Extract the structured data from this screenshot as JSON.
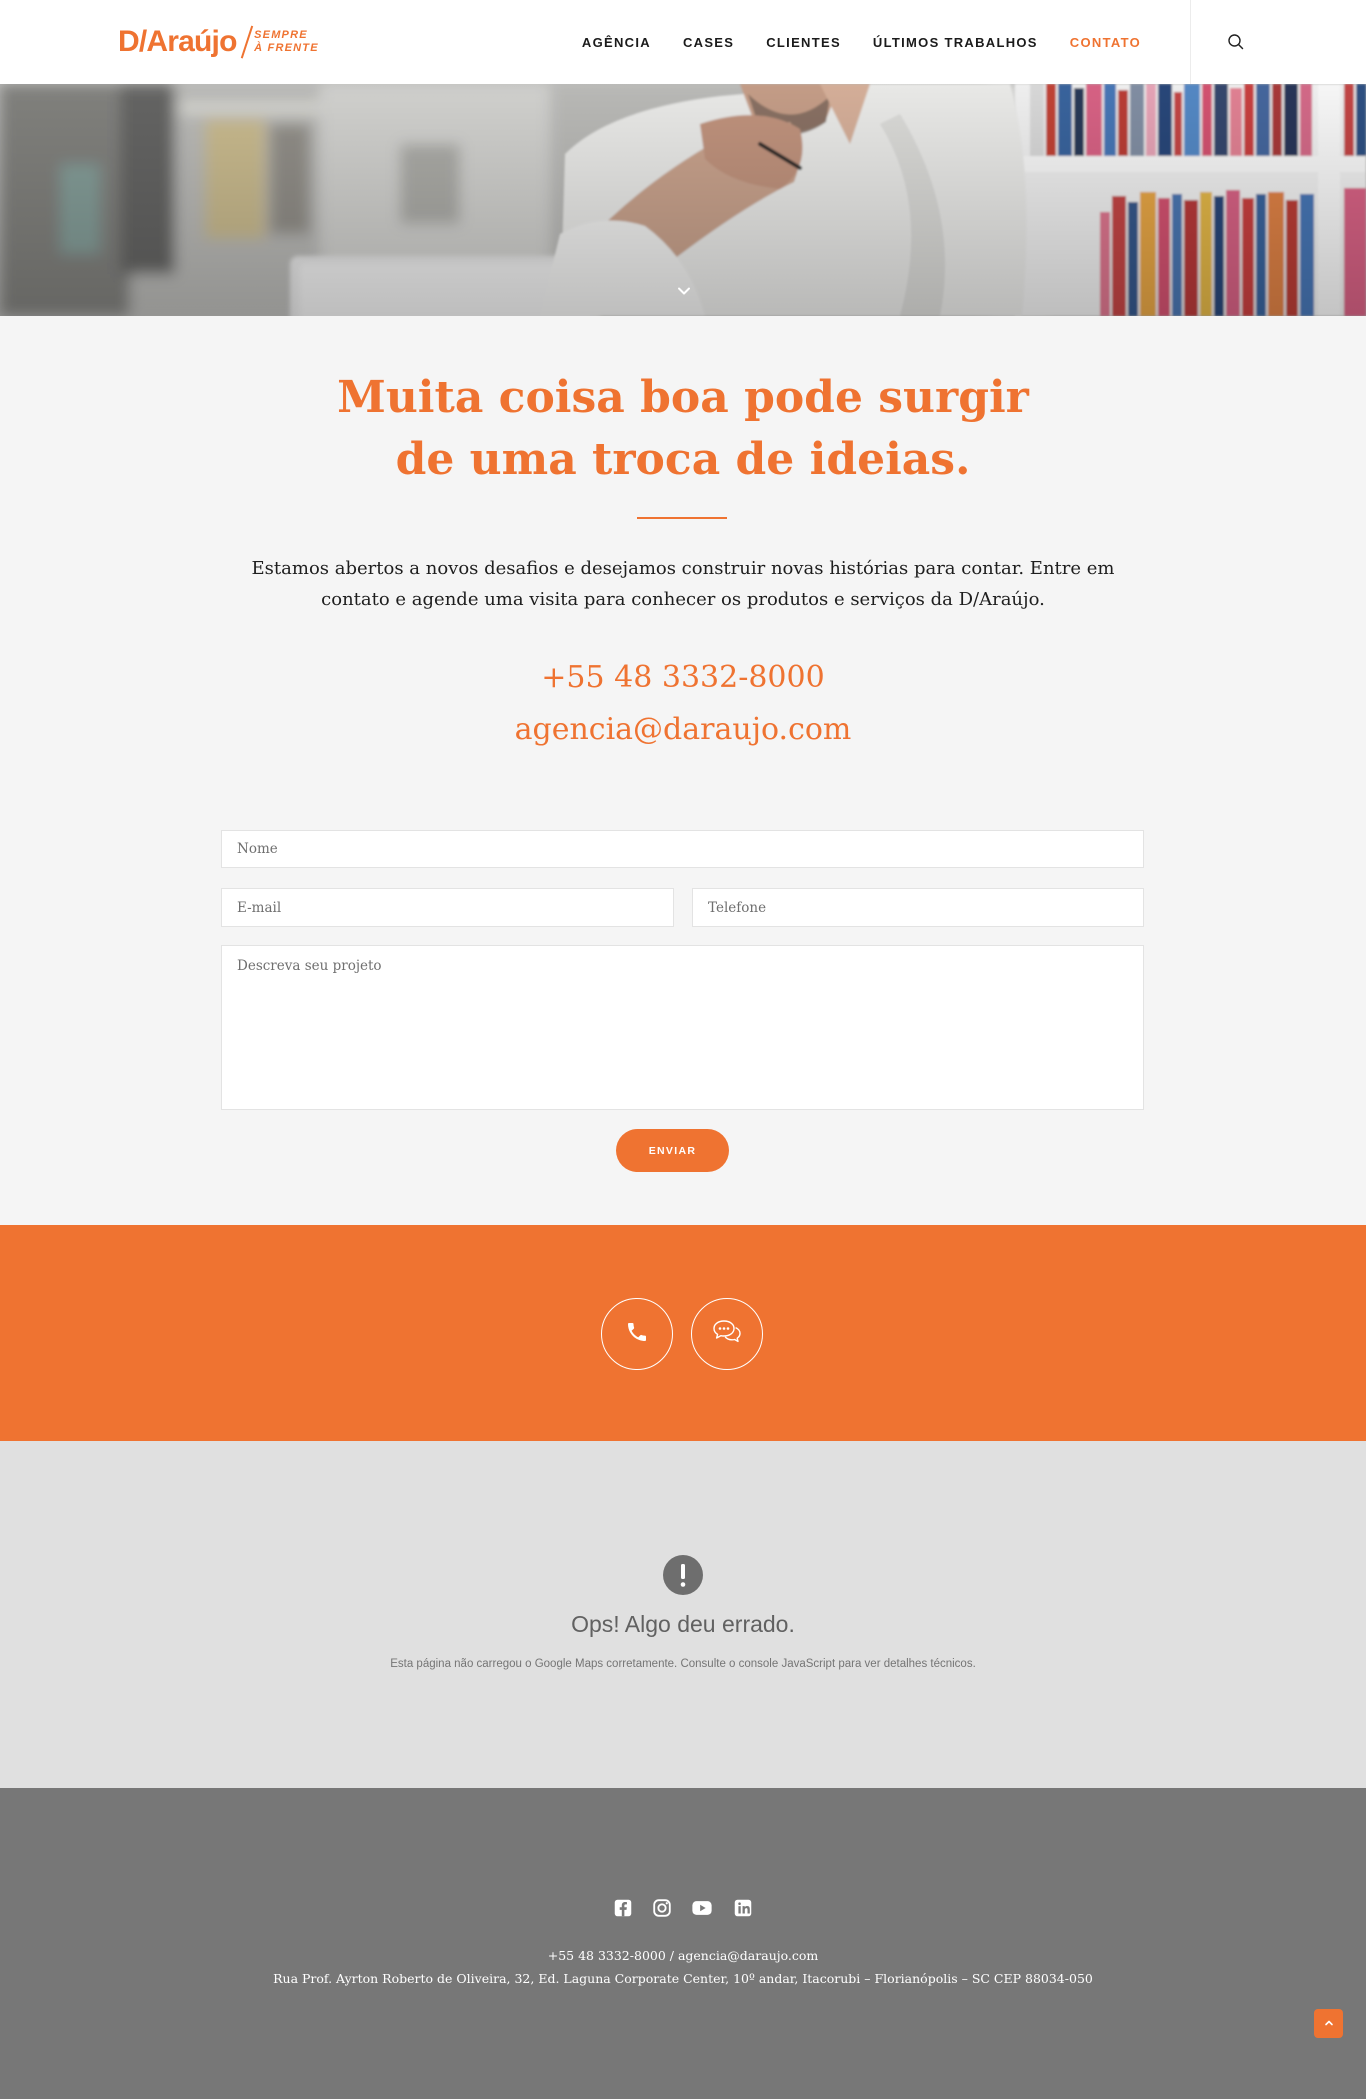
{
  "colors": {
    "accent": "#ef7331",
    "section_bg": "#f5f5f5",
    "map_bg": "#e0e0e0",
    "footer_bg": "#777777"
  },
  "brand": {
    "name": "D/Araújo",
    "tagline_line1": "SEMPRE",
    "tagline_line2": "À FRENTE"
  },
  "nav": {
    "items": [
      {
        "label": "AGÊNCIA"
      },
      {
        "label": "CASES"
      },
      {
        "label": "CLIENTES"
      },
      {
        "label": "ÚLTIMOS TRABALHOS"
      },
      {
        "label": "CONTATO",
        "active": true
      }
    ],
    "search_icon": "search-icon"
  },
  "hero": {
    "scroll_icon": "chevron-down-icon"
  },
  "contact": {
    "heading_line1": "Muita coisa boa pode surgir",
    "heading_line2": "de uma troca de ideias.",
    "intro": "Estamos abertos a novos desafios e desejamos construir novas histórias para contar. Entre em contato e agende uma visita para conhecer os produtos e serviços da D/Araújo.",
    "phone": "+55 48 3332-8000",
    "email": "agencia@daraujo.com"
  },
  "form": {
    "name_placeholder": "Nome",
    "email_placeholder": "E-mail",
    "phone_placeholder": "Telefone",
    "message_placeholder": "Descreva seu projeto",
    "submit_label": "ENVIAR"
  },
  "cta_band": {
    "buttons": [
      {
        "icon": "phone-icon"
      },
      {
        "icon": "chat-icon"
      }
    ]
  },
  "map_error": {
    "icon": "exclamation-icon",
    "title": "Ops! Algo deu errado.",
    "message": "Esta página não carregou o Google Maps corretamente. Consulte o console JavaScript para ver detalhes técnicos."
  },
  "footer": {
    "social": [
      "facebook-icon",
      "instagram-icon",
      "youtube-icon",
      "linkedin-icon"
    ],
    "contact_line": "+55 48 3332-8000 / agencia@daraujo.com",
    "address": "Rua Prof. Ayrton Roberto de Oliveira, 32, Ed. Laguna Corporate Center, 10º andar, Itacorubi – Florianópolis – SC CEP 88034-050"
  },
  "back_to_top": {
    "icon": "chevron-up-icon"
  }
}
